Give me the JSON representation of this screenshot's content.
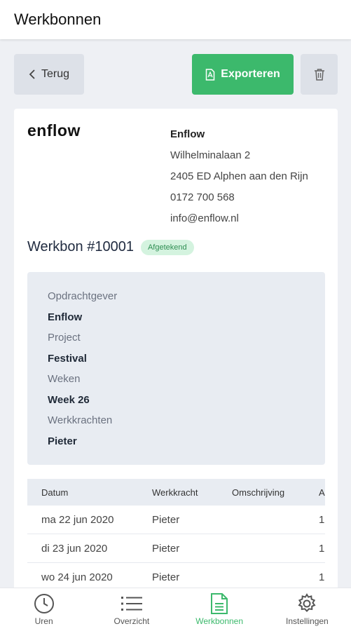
{
  "app": {
    "title": "Werkbonnen"
  },
  "actions": {
    "back_label": "Terug",
    "export_label": "Exporteren"
  },
  "company": {
    "logo_text": "enflow",
    "name": "Enflow",
    "address_line1": "Wilhelminalaan 2",
    "address_line2": "2405 ED Alphen aan den Rijn",
    "phone": "0172 700 568",
    "email": "info@enflow.nl"
  },
  "workorder": {
    "title": "Werkbon #10001",
    "status": "Afgetekend",
    "fields": [
      {
        "label": "Opdrachtgever",
        "value": "Enflow"
      },
      {
        "label": "Project",
        "value": "Festival"
      },
      {
        "label": "Weken",
        "value": "Week 26"
      },
      {
        "label": "Werkkrachten",
        "value": "Pieter"
      }
    ]
  },
  "table": {
    "headers": [
      "Datum",
      "Werkkracht",
      "Omschrijving",
      "A"
    ],
    "rows": [
      {
        "datum": "ma 22 jun 2020",
        "werkkracht": "Pieter",
        "omschrijving": "",
        "a": "1"
      },
      {
        "datum": "di 23 jun 2020",
        "werkkracht": "Pieter",
        "omschrijving": "",
        "a": "1"
      },
      {
        "datum": "wo 24 jun 2020",
        "werkkracht": "Pieter",
        "omschrijving": "",
        "a": "1"
      }
    ]
  },
  "nav": {
    "items": [
      {
        "label": "Uren",
        "icon": "clock-icon",
        "active": false
      },
      {
        "label": "Overzicht",
        "icon": "list-icon",
        "active": false
      },
      {
        "label": "Werkbonnen",
        "icon": "document-icon",
        "active": true
      },
      {
        "label": "Instellingen",
        "icon": "gear-icon",
        "active": false
      }
    ]
  },
  "colors": {
    "accent": "#3cb96c",
    "badge_bg": "#d4f3df",
    "badge_text": "#2f8f53"
  }
}
